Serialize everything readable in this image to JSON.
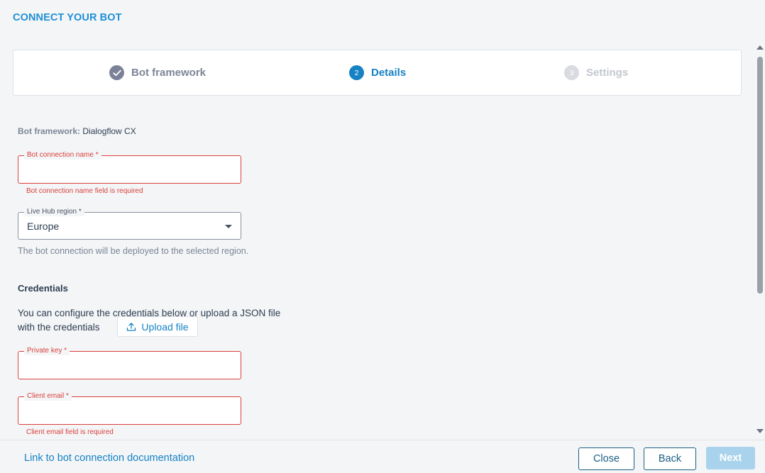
{
  "header": {
    "title": "CONNECT YOUR BOT"
  },
  "stepper": {
    "steps": [
      {
        "number": "",
        "label": "Bot framework",
        "state": "done"
      },
      {
        "number": "2",
        "label": "Details",
        "state": "active"
      },
      {
        "number": "3",
        "label": "Settings",
        "state": "pending"
      }
    ]
  },
  "form": {
    "framework_label": "Bot framework:",
    "framework_value": "Dialogflow CX",
    "bot_name": {
      "label": "Bot connection name *",
      "value": "",
      "error": "Bot connection name field is required"
    },
    "region": {
      "label": "Live Hub region *",
      "value": "Europe",
      "helper": "The bot connection will be deployed to the selected region."
    },
    "credentials": {
      "title": "Credentials",
      "text_line1": "You can configure the credentials below or upload a JSON file",
      "text_line2": "with the credentials",
      "upload_label": "Upload file"
    },
    "private_key": {
      "label": "Private key *",
      "value": ""
    },
    "client_email": {
      "label": "Client email *",
      "value": "",
      "error": "Client email field is required"
    }
  },
  "footer": {
    "doc_link": "Link to bot connection documentation",
    "close_label": "Close",
    "back_label": "Back",
    "next_label": "Next"
  },
  "colors": {
    "accent": "#1582c4",
    "error": "#d9413b",
    "title": "#1e8fd6"
  }
}
